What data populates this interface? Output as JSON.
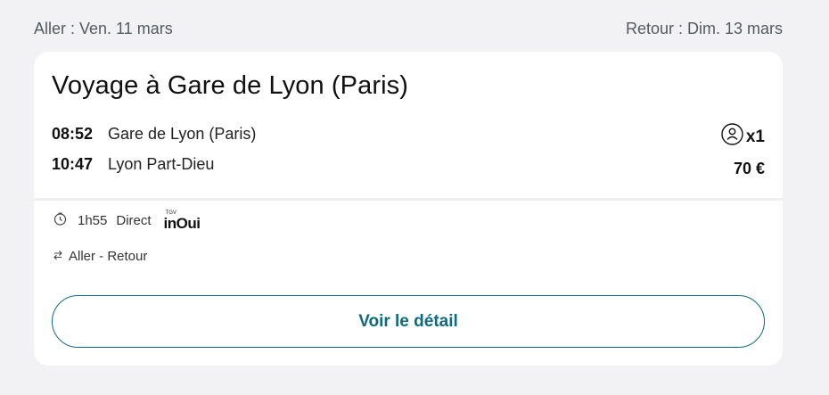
{
  "header": {
    "outbound": "Aller : Ven. 11 mars",
    "return": "Retour : Dim. 13 mars"
  },
  "card": {
    "title": "Voyage à Gare de Lyon (Paris)",
    "departure": {
      "time": "08:52",
      "station": "Gare de Lyon (Paris)"
    },
    "arrival": {
      "time": "10:47",
      "station": "Lyon Part-Dieu"
    },
    "passengers": "x1",
    "price": "70 €",
    "duration": "1h55",
    "type": "Direct",
    "brand_small": "TGV",
    "brand": "inOui",
    "trip_kind": "Aller - Retour",
    "details_button": "Voir le détail"
  },
  "icons": {
    "duration": "clock-icon",
    "passenger": "person-icon",
    "trip": "swap-arrows-icon"
  },
  "colors": {
    "accent": "#0e6a7c",
    "background": "#f2f2f4",
    "card": "#ffffff"
  }
}
